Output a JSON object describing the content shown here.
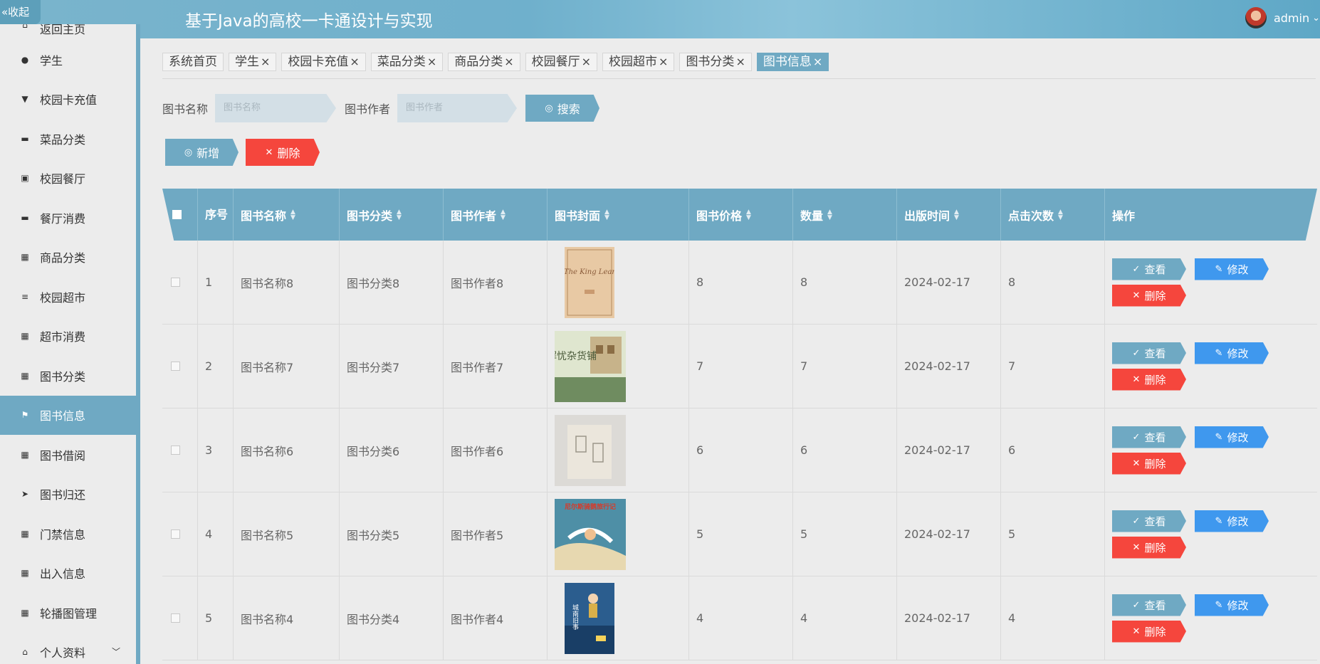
{
  "header": {
    "collapse_label": "«收起",
    "app_title": "基于Java的高校一卡通设计与实现",
    "user_name": "admin",
    "user_caret": "⌄"
  },
  "sidebar": {
    "items": [
      {
        "label": "返回主页",
        "icon": "home-icon"
      },
      {
        "label": "学生",
        "icon": "user-icon"
      },
      {
        "label": "校园卡充值",
        "icon": "card-icon"
      },
      {
        "label": "菜品分类",
        "icon": "comment-icon"
      },
      {
        "label": "校园餐厅",
        "icon": "clipboard-icon"
      },
      {
        "label": "餐厅消费",
        "icon": "monitor-icon"
      },
      {
        "label": "商品分类",
        "icon": "grid-icon"
      },
      {
        "label": "校园超市",
        "icon": "list-icon"
      },
      {
        "label": "超市消费",
        "icon": "grid-icon"
      },
      {
        "label": "图书分类",
        "icon": "grid-icon"
      },
      {
        "label": "图书信息",
        "icon": "flag-icon"
      },
      {
        "label": "图书借阅",
        "icon": "grid-icon"
      },
      {
        "label": "图书归还",
        "icon": "send-icon"
      },
      {
        "label": "门禁信息",
        "icon": "grid-icon"
      },
      {
        "label": "出入信息",
        "icon": "grid-icon"
      },
      {
        "label": "轮播图管理",
        "icon": "grid-icon"
      },
      {
        "label": "个人资料",
        "icon": "home-icon"
      }
    ],
    "active": "图书信息"
  },
  "tabs": [
    "系统首页",
    "学生",
    "校园卡充值",
    "菜品分类",
    "商品分类",
    "校园餐厅",
    "校园超市",
    "图书分类",
    "图书信息"
  ],
  "tab_close": "×",
  "search": {
    "name_label": "图书名称",
    "name_placeholder": "图书名称",
    "author_label": "图书作者",
    "author_placeholder": "图书作者",
    "search_button": "搜索"
  },
  "toolbar": {
    "add_label": "新增",
    "delete_label": "删除"
  },
  "table": {
    "columns": [
      "序号",
      "图书名称",
      "图书分类",
      "图书作者",
      "图书封面",
      "图书价格",
      "数量",
      "出版时间",
      "点击次数",
      "操作"
    ],
    "rows": [
      {
        "no": "1",
        "name": "图书名称8",
        "category": "图书分类8",
        "author": "图书作者8",
        "price": "8",
        "qty": "8",
        "date": "2024-02-17",
        "clicks": "8",
        "cover_title": "The King Lear"
      },
      {
        "no": "2",
        "name": "图书名称7",
        "category": "图书分类7",
        "author": "图书作者7",
        "price": "7",
        "qty": "7",
        "date": "2024-02-17",
        "clicks": "7",
        "cover_title": "解忧杂货铺"
      },
      {
        "no": "3",
        "name": "图书名称6",
        "category": "图书分类6",
        "author": "图书作者6",
        "price": "6",
        "qty": "6",
        "date": "2024-02-17",
        "clicks": "6",
        "cover_title": ""
      },
      {
        "no": "4",
        "name": "图书名称5",
        "category": "图书分类5",
        "author": "图书作者5",
        "price": "5",
        "qty": "5",
        "date": "2024-02-17",
        "clicks": "5",
        "cover_title": "尼尔斯骑鹅旅行记"
      },
      {
        "no": "5",
        "name": "图书名称4",
        "category": "图书分类4",
        "author": "图书作者4",
        "price": "4",
        "qty": "4",
        "date": "2024-02-17",
        "clicks": "4",
        "cover_title": "城南旧事"
      }
    ],
    "view_label": "查看",
    "edit_label": "修改",
    "delete_label": "删除"
  },
  "colors": {
    "accent": "#6fa9c3",
    "danger": "#f5463d",
    "primary": "#3f98ee"
  }
}
